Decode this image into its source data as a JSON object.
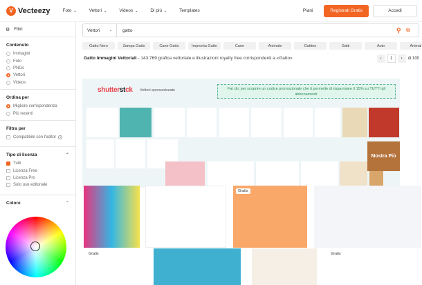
{
  "header": {
    "logo": "Vecteezy",
    "nav": [
      "Foto",
      "Vettori",
      "Videos",
      "Di più"
    ],
    "templates": "Templates",
    "piani": "Piani",
    "register": "Registrati Gratis",
    "login": "Accedi"
  },
  "sidebar": {
    "filters": "Filtri",
    "content": {
      "title": "Contenuto",
      "options": [
        "Immagini",
        "Foto",
        "PNGs",
        "Vettori",
        "Videos"
      ],
      "selected": 3
    },
    "order": {
      "title": "Ordina per",
      "options": [
        "Migliore corrispondenza",
        "Più recenti"
      ],
      "selected": 0
    },
    "filter": {
      "title": "Filtra per",
      "options": [
        "Compatibile con l'editor"
      ]
    },
    "license": {
      "title": "Tipo di licenza",
      "options": [
        "Tutti",
        "Licenza Free",
        "Licenza Pro",
        "Solo uso editoriale"
      ],
      "selected": 0
    },
    "color": {
      "title": "Colore"
    }
  },
  "search": {
    "type": "Vettori",
    "query": "gatto"
  },
  "tags": [
    "Gatto Nero",
    "Zampa Gatto",
    "Cane Gatto",
    "Impronta Gatto",
    "Cane",
    "Animale",
    "Gattino",
    "Gatti",
    "Auto",
    "Animali",
    "Carino"
  ],
  "results": {
    "title": "Gatto Immagini Vettoriali",
    "desc": "- 143.769 grafica vettoriale e illustrazioni royalty free corrispondenti a «Gatto»",
    "page": "1",
    "of": "di 100"
  },
  "sponsored": {
    "logo_a": "shutter",
    "logo_b": "st",
    "logo_c": "ck",
    "label": "Vettori sponsorizzate",
    "promo": "Fai clic per scoprire un codice promozionale che ti permette di risparmiare il 15% su TUTTI gli abbonamenti.",
    "more": "Mostra Più"
  },
  "badges": {
    "free": "Gratis"
  },
  "colors": {
    "accent": "#f26522",
    "promo_text": "#2e8b57"
  }
}
